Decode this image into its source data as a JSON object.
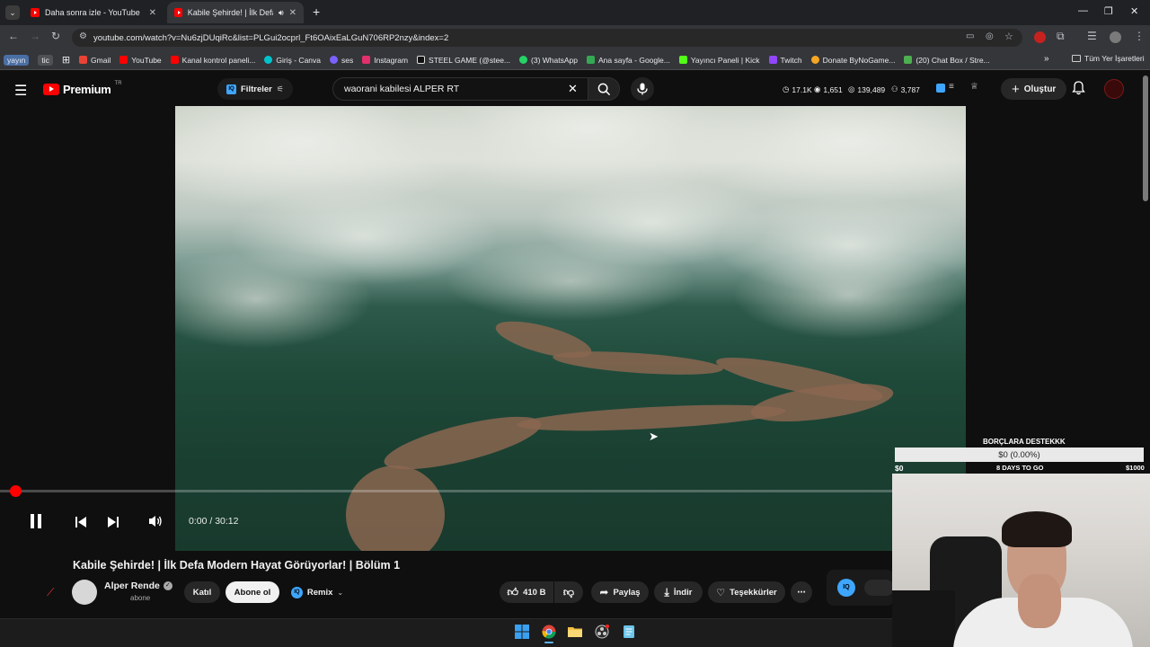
{
  "browser": {
    "tabs": [
      {
        "title": "Daha sonra izle - YouTube"
      },
      {
        "title": "Kabile Şehirde! | İlk Defa M"
      }
    ],
    "url": "youtube.com/watch?v=Nu6zjDUqiRc&list=PLGui2ocprl_Ft6OAixEaLGuN706RP2nzy&index=2",
    "bookmarks": [
      {
        "label": "yayın",
        "icon": "chip"
      },
      {
        "label": "tic",
        "icon": "chip"
      },
      {
        "label": "Gmail",
        "icon": "gmail-icon",
        "color": "#ea4335"
      },
      {
        "label": "YouTube",
        "icon": "youtube-icon",
        "color": "#ff0000"
      },
      {
        "label": "Kanal kontrol paneli...",
        "icon": "youtube-studio-icon",
        "color": "#ff0000"
      },
      {
        "label": "Giriş - Canva",
        "icon": "canva-icon",
        "color": "#00c4cc"
      },
      {
        "label": "ses",
        "icon": "ses-icon",
        "color": "#7b61ff"
      },
      {
        "label": "Instagram",
        "icon": "instagram-icon",
        "color": "#e1306c"
      },
      {
        "label": "STEEL GAME (@stee...",
        "icon": "tiktok-icon",
        "color": "#ffffff"
      },
      {
        "label": "(3) WhatsApp",
        "icon": "whatsapp-icon",
        "color": "#25d366"
      },
      {
        "label": "Ana sayfa - Google...",
        "icon": "google-drive-icon",
        "color": "#34a853"
      },
      {
        "label": "Yayıncı Paneli | Kick",
        "icon": "kick-icon",
        "color": "#53fc18"
      },
      {
        "label": "Twitch",
        "icon": "twitch-icon",
        "color": "#9146ff"
      },
      {
        "label": "Donate ByNoGame...",
        "icon": "bynogame-icon",
        "color": "#f5a623"
      },
      {
        "label": "(20) Chat Box / Stre...",
        "icon": "chatbox-icon",
        "color": "#4caf50"
      }
    ],
    "all_bookmarks": "Tüm Yer İşaretleri"
  },
  "youtube": {
    "logo": "Premium",
    "logo_region": "TR",
    "filters_label": "Filtreler",
    "search_value": "waorani kabilesi ALPER RT",
    "stats": [
      {
        "icon": "clock-icon",
        "value": "17.1K"
      },
      {
        "icon": "eye-icon",
        "value": "1,651"
      },
      {
        "icon": "views-icon",
        "value": "139,489"
      },
      {
        "icon": "user-icon",
        "value": "3,787"
      }
    ],
    "create_label": "Oluştur"
  },
  "player": {
    "time": "0:00 / 30:12",
    "progress": 0.0
  },
  "video": {
    "title": "Kabile Şehirde! | İlk Defa Modern Hayat Görüyorlar! | Bölüm 1",
    "channel": "Alper Rende",
    "subscribers": "abone",
    "join_label": "Katıl",
    "subscribe_label": "Abone ol",
    "remix_label": "Remix",
    "likes": "410 B",
    "share_label": "Paylaş",
    "download_label": "İndir",
    "thanks_label": "Teşekkürler"
  },
  "donation": {
    "title": "BORÇLARA DESTEKKK",
    "amount": "$0 (0.00%)",
    "min": "$0",
    "days": "8 DAYS TO GO",
    "max": "$1000"
  },
  "colors": {
    "accent": "#ff0000",
    "background": "#0f0f0f"
  }
}
